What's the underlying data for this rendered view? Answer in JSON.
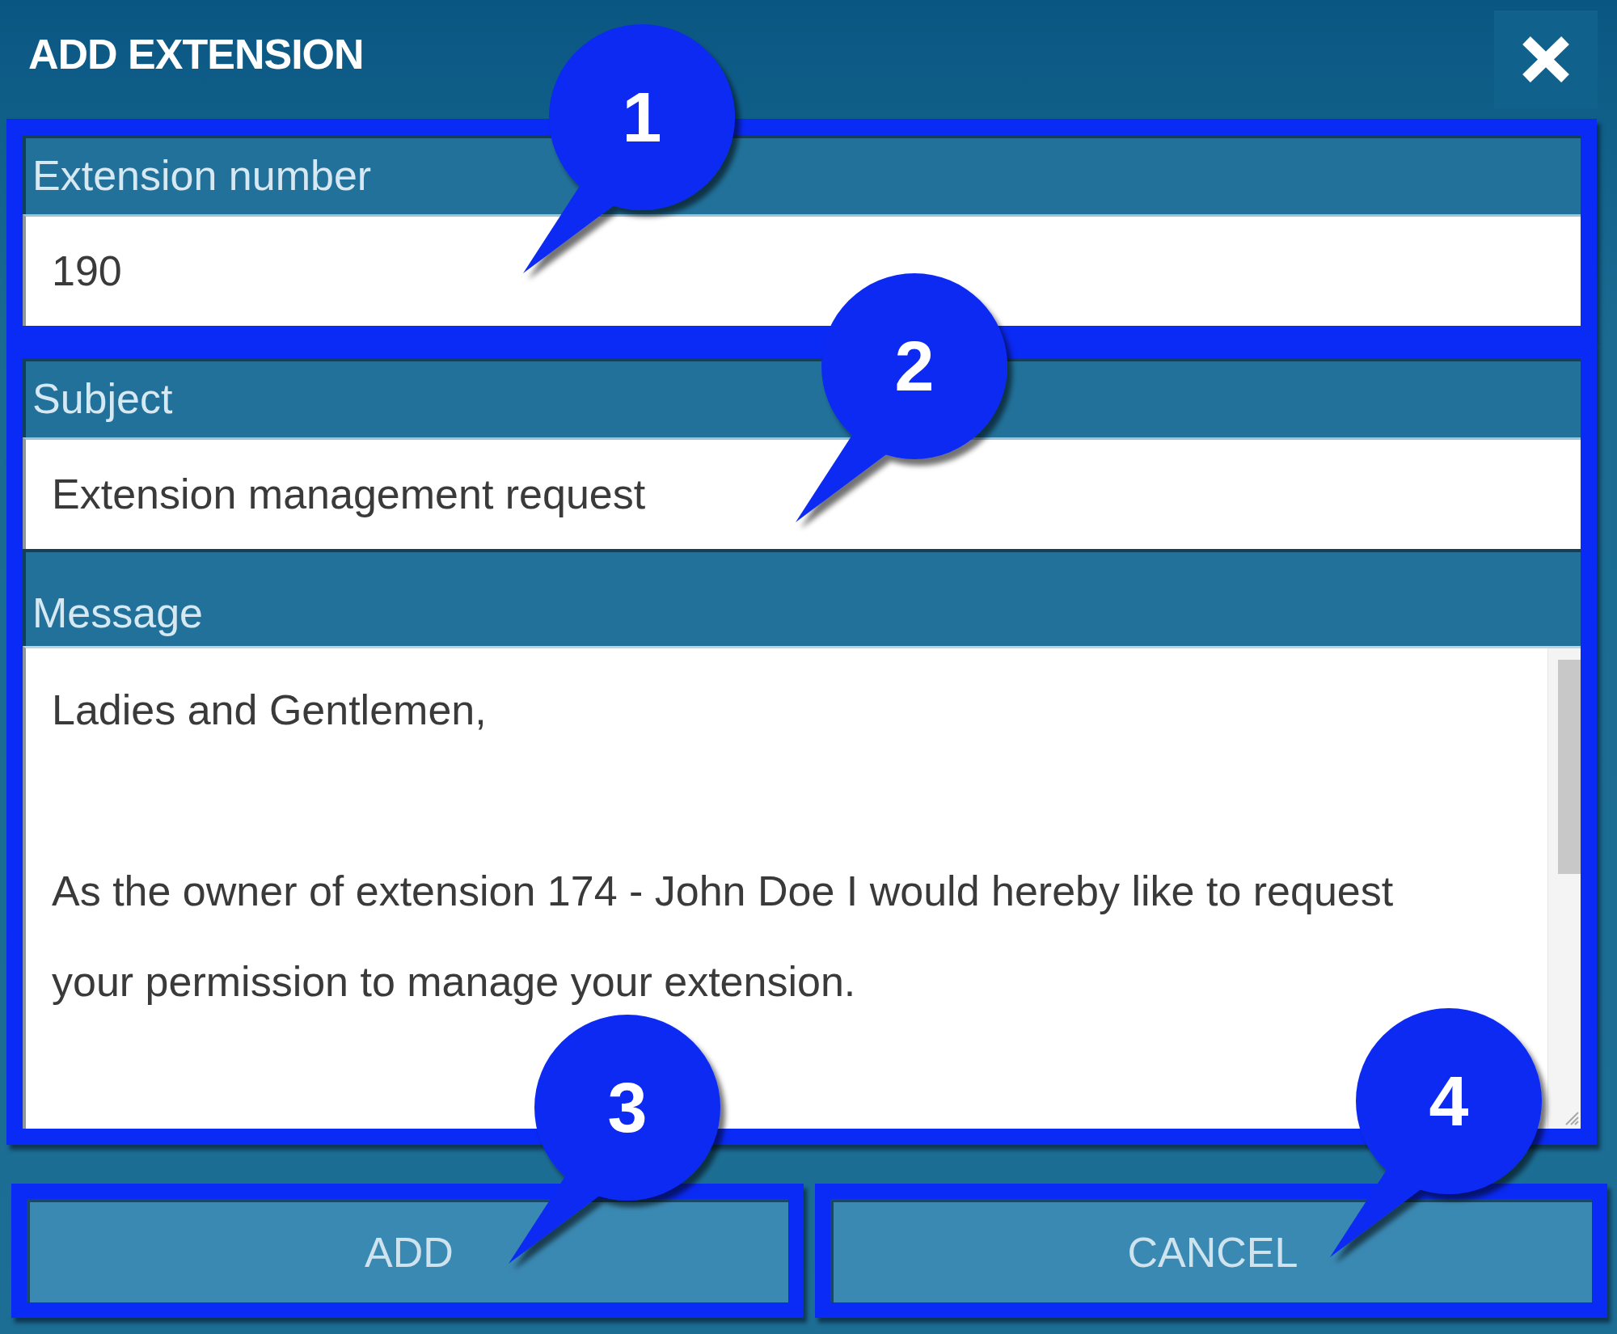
{
  "dialog": {
    "title": "ADD EXTENSION"
  },
  "form_groups": [
    {
      "callout": "1",
      "fields": [
        {
          "kind": "input",
          "label": "Extension number",
          "value": "190"
        }
      ]
    },
    {
      "callout": "2",
      "fields": [
        {
          "kind": "input",
          "label": "Subject",
          "value": "Extension management request"
        },
        {
          "kind": "textarea",
          "label": "Message",
          "value": "Ladies and Gentlemen,\n\nAs the owner of extension 174 - John Doe I would hereby like to request\nyour permission to manage your extension."
        }
      ]
    }
  ],
  "buttons": [
    {
      "label": "ADD",
      "callout": "3"
    },
    {
      "label": "CANCEL",
      "callout": "4"
    }
  ]
}
